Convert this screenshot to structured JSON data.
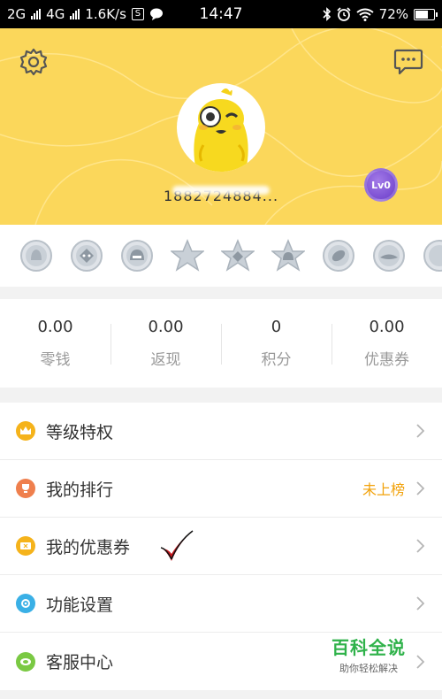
{
  "status_bar": {
    "sim1": "2G",
    "sim2": "4G",
    "speed": "1.6K/s",
    "s_icon": "S",
    "time": "14:47",
    "battery": "72%",
    "battery_level": 0.72
  },
  "profile": {
    "username": "1882724884...",
    "level_badge": "Lv0"
  },
  "medals": [
    "medal-1",
    "medal-2",
    "medal-3",
    "medal-4",
    "medal-5",
    "medal-6",
    "medal-7",
    "medal-8",
    "medal-9"
  ],
  "stats": [
    {
      "value": "0.00",
      "label": "零钱"
    },
    {
      "value": "0.00",
      "label": "返现"
    },
    {
      "value": "0",
      "label": "积分"
    },
    {
      "value": "0.00",
      "label": "优惠券"
    }
  ],
  "menu": [
    {
      "label": "等级特权",
      "extra": "",
      "icon": "crown-icon",
      "color": "#f5b31b"
    },
    {
      "label": "我的排行",
      "extra": "未上榜",
      "icon": "trophy-icon",
      "color": "#ef7f4d"
    },
    {
      "label": "我的优惠券",
      "extra": "",
      "icon": "coupon-icon",
      "color": "#f5b31b"
    },
    {
      "label": "功能设置",
      "extra": "",
      "icon": "gear-icon",
      "color": "#3ab0e6"
    },
    {
      "label": "客服中心",
      "extra": "",
      "icon": "headset-icon",
      "color": "#7ac943"
    }
  ],
  "watermark": {
    "title": "百科全说",
    "subtitle": "助你轻松解决"
  },
  "colors": {
    "header_bg": "#fbd75b",
    "accent_orange": "#f2a20b",
    "watermark_green": "#2fb24a"
  }
}
